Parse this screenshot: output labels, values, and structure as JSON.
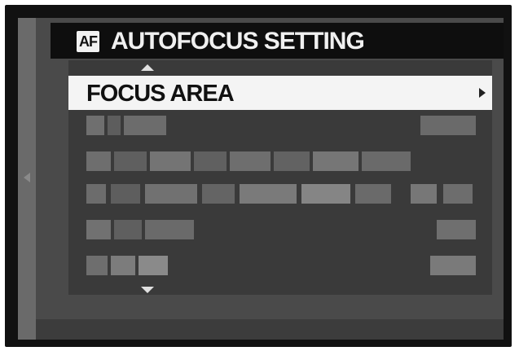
{
  "title_bar": {
    "badge": "AF",
    "title": "AUTOFOCUS SETTING"
  },
  "menu": {
    "selected_item": {
      "label": "FOCUS AREA",
      "chevron": "chevron-right-icon"
    },
    "blurred_items_count_note": "",
    "scroll_up_icon": "triangle-up-icon",
    "scroll_down_icon": "triangle-down-icon"
  },
  "side": {
    "left_icon": "triangle-left-icon"
  }
}
